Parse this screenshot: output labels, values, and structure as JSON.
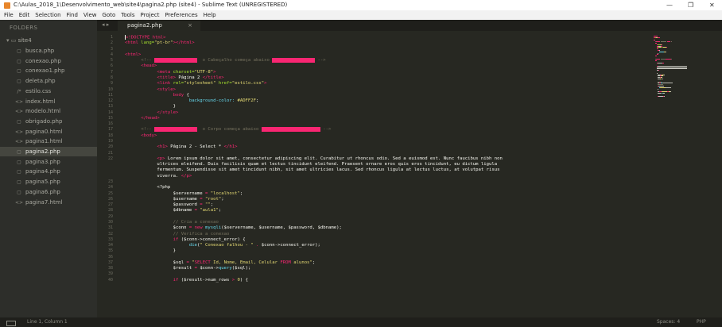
{
  "window": {
    "title": "C:\\Aulas_2018_1\\Desenvolvimento_web\\site4\\pagina2.php (site4) - Sublime Text (UNREGISTERED)",
    "minimize": "—",
    "maximize": "❐",
    "close": "✕"
  },
  "menu": [
    "File",
    "Edit",
    "Selection",
    "Find",
    "View",
    "Goto",
    "Tools",
    "Project",
    "Preferences",
    "Help"
  ],
  "sidebar": {
    "header": "FOLDERS",
    "root": "site4",
    "items": [
      {
        "icon": "file-icon",
        "glyph": "▢",
        "label": "busca.php"
      },
      {
        "icon": "file-icon",
        "glyph": "▢",
        "label": "conexao.php"
      },
      {
        "icon": "file-icon",
        "glyph": "▢",
        "label": "conexao1.php"
      },
      {
        "icon": "file-icon",
        "glyph": "▢",
        "label": "deleta.php"
      },
      {
        "icon": "css-file-icon",
        "glyph": "/*",
        "label": "estilo.css"
      },
      {
        "icon": "html-file-icon",
        "glyph": "<>",
        "label": "index.html"
      },
      {
        "icon": "html-file-icon",
        "glyph": "<>",
        "label": "modelo.html"
      },
      {
        "icon": "file-icon",
        "glyph": "▢",
        "label": "obrigado.php"
      },
      {
        "icon": "html-file-icon",
        "glyph": "<>",
        "label": "pagina0.html"
      },
      {
        "icon": "html-file-icon",
        "glyph": "<>",
        "label": "pagina1.html"
      },
      {
        "icon": "file-icon",
        "glyph": "▢",
        "label": "pagina2.php",
        "selected": true
      },
      {
        "icon": "file-icon",
        "glyph": "▢",
        "label": "pagina3.php"
      },
      {
        "icon": "file-icon",
        "glyph": "▢",
        "label": "pagina4.php"
      },
      {
        "icon": "file-icon",
        "glyph": "▢",
        "label": "pagina5.php"
      },
      {
        "icon": "file-icon",
        "glyph": "▢",
        "label": "pagina6.php"
      },
      {
        "icon": "html-file-icon",
        "glyph": "<>",
        "label": "pagina7.html"
      }
    ]
  },
  "tab": {
    "nav": "◂ ▸",
    "label": "pagina2.php",
    "close": "×"
  },
  "editor": {
    "lines": [
      {
        "n": "1",
        "segs": [
          [
            "tg",
            "<!DOCTYPE html>"
          ]
        ],
        "cursor": true
      },
      {
        "n": "2",
        "segs": [
          [
            "tg",
            "<html "
          ],
          [
            "at",
            "lang="
          ],
          [
            "st",
            "\"pt-br\""
          ],
          [
            "tg",
            "></html>"
          ]
        ]
      },
      {
        "n": "3",
        "segs": []
      },
      {
        "n": "4",
        "segs": [
          [
            "tg",
            "<html>"
          ]
        ]
      },
      {
        "n": "5",
        "segs": [
          [
            "cm",
            "      <!-- "
          ],
          [
            "hl",
            "================"
          ],
          [
            "cm",
            "  o Cabeçalho começa abaixo "
          ],
          [
            "hl",
            "================"
          ],
          [
            "cm",
            " -->"
          ]
        ]
      },
      {
        "n": "6",
        "segs": [
          [
            "tg",
            "      <head>"
          ]
        ]
      },
      {
        "n": "7",
        "segs": [
          [
            "tg",
            "            <meta "
          ],
          [
            "at",
            "charset="
          ],
          [
            "st",
            "\"UTF-8\""
          ],
          [
            "tg",
            ">"
          ]
        ]
      },
      {
        "n": "8",
        "segs": [
          [
            "tg",
            "            <title>"
          ],
          [
            "vr",
            " Página 2 "
          ],
          [
            "tg",
            "</title>"
          ]
        ]
      },
      {
        "n": "9",
        "segs": [
          [
            "tg",
            "            <link "
          ],
          [
            "at",
            "rel="
          ],
          [
            "st",
            "\"stylesheet\" "
          ],
          [
            "at",
            "href="
          ],
          [
            "st",
            "\"estilo.css\""
          ],
          [
            "tg",
            ">"
          ]
        ]
      },
      {
        "n": "10",
        "segs": [
          [
            "tg",
            "            <style>"
          ]
        ]
      },
      {
        "n": "11",
        "segs": [
          [
            "tg",
            "                  body "
          ],
          [
            "vr",
            "{"
          ]
        ]
      },
      {
        "n": "12",
        "segs": [
          [
            "fn",
            "                        background-color: "
          ],
          [
            "st",
            "#ADFF2F"
          ],
          [
            "vr",
            ";"
          ]
        ]
      },
      {
        "n": "13",
        "segs": [
          [
            "vr",
            "                  }"
          ]
        ]
      },
      {
        "n": "14",
        "segs": [
          [
            "tg",
            "            </style>"
          ]
        ]
      },
      {
        "n": "15",
        "segs": [
          [
            "tg",
            "      </head>"
          ]
        ]
      },
      {
        "n": "16",
        "segs": []
      },
      {
        "n": "17",
        "segs": [
          [
            "cm",
            "      <!-- "
          ],
          [
            "hl",
            "================"
          ],
          [
            "cm",
            "  o Corpo começa abaixo "
          ],
          [
            "hl",
            "======================"
          ],
          [
            "cm",
            " -->"
          ]
        ]
      },
      {
        "n": "18",
        "segs": [
          [
            "tg",
            "      <body>"
          ]
        ]
      },
      {
        "n": "19",
        "segs": []
      },
      {
        "n": "20",
        "segs": [
          [
            "tg",
            "            <h1>"
          ],
          [
            "vr",
            " Página 2 - Select * "
          ],
          [
            "tg",
            "</h1>"
          ]
        ]
      },
      {
        "n": "21",
        "segs": []
      },
      {
        "n": "22",
        "segs": [
          [
            "tg",
            "            <p>"
          ],
          [
            "vr",
            " Lorem ipsum dolor sit amet, consectetur adipiscing elit. Curabitur ut rhoncus odio. Sed a euismod est. Nunc faucibus nibh non"
          ]
        ]
      },
      {
        "n": "",
        "segs": [
          [
            "vr",
            "            ultrices eleifend. Duis facilisis quam et lectus tincidunt eleifend. Praesent ornare eros quis eros tincidunt, eu dictum ligula"
          ]
        ]
      },
      {
        "n": "",
        "segs": [
          [
            "vr",
            "            fermentum. Suspendisse sit amet tincidunt nibh, sit amet ultricies lacus. Sed rhoncus ligula at lectus luctus, at volutpat risus"
          ]
        ]
      },
      {
        "n": "",
        "segs": [
          [
            "vr",
            "            viverra. "
          ],
          [
            "tg",
            "</p>"
          ]
        ]
      },
      {
        "n": "23",
        "segs": []
      },
      {
        "n": "24",
        "segs": [
          [
            "vr",
            "            <?php"
          ]
        ]
      },
      {
        "n": "25",
        "segs": [
          [
            "vr",
            "                  $servername "
          ],
          [
            "kw",
            "= "
          ],
          [
            "st",
            "\"localhost\""
          ],
          [
            "vr",
            ";"
          ]
        ]
      },
      {
        "n": "26",
        "segs": [
          [
            "vr",
            "                  $username "
          ],
          [
            "kw",
            "= "
          ],
          [
            "st",
            "\"root\""
          ],
          [
            "vr",
            ";"
          ]
        ]
      },
      {
        "n": "27",
        "segs": [
          [
            "vr",
            "                  $password "
          ],
          [
            "kw",
            "= "
          ],
          [
            "st",
            "\"\""
          ],
          [
            "vr",
            ";"
          ]
        ]
      },
      {
        "n": "28",
        "segs": [
          [
            "vr",
            "                  $dbname "
          ],
          [
            "kw",
            "= "
          ],
          [
            "st",
            "\"aula1\""
          ],
          [
            "vr",
            ";"
          ]
        ]
      },
      {
        "n": "29",
        "segs": []
      },
      {
        "n": "30",
        "segs": [
          [
            "cm",
            "                  // Cria a conexao"
          ]
        ]
      },
      {
        "n": "31",
        "segs": [
          [
            "vr",
            "                  $conn "
          ],
          [
            "kw",
            "= new "
          ],
          [
            "fn",
            "mysqli"
          ],
          [
            "vr",
            "($servername, $username, $password, $dbname);"
          ]
        ]
      },
      {
        "n": "32",
        "segs": [
          [
            "cm",
            "                  // Verifica a conexao"
          ]
        ]
      },
      {
        "n": "33",
        "segs": [
          [
            "kw",
            "                  if "
          ],
          [
            "vr",
            "($conn->connect_error) {"
          ]
        ]
      },
      {
        "n": "34",
        "segs": [
          [
            "fn",
            "                        die"
          ],
          [
            "vr",
            "("
          ],
          [
            "st",
            "\" Conexao falhou - \" "
          ],
          [
            "kw",
            ". "
          ],
          [
            "vr",
            "$conn->connect_error);"
          ]
        ]
      },
      {
        "n": "35",
        "segs": [
          [
            "vr",
            "                  }"
          ]
        ]
      },
      {
        "n": "36",
        "segs": []
      },
      {
        "n": "37",
        "segs": [
          [
            "vr",
            "                  $sql "
          ],
          [
            "kw",
            "= "
          ],
          [
            "st",
            "\""
          ],
          [
            "kw",
            "SELECT "
          ],
          [
            "st",
            "Id, Nome, Email, Celular "
          ],
          [
            "kw",
            "FROM "
          ],
          [
            "st",
            "alunos\""
          ],
          [
            "vr",
            ";"
          ]
        ]
      },
      {
        "n": "38",
        "segs": [
          [
            "vr",
            "                  $result "
          ],
          [
            "kw",
            "= "
          ],
          [
            "vr",
            "$conn->"
          ],
          [
            "fn",
            "query"
          ],
          [
            "vr",
            "($sql);"
          ]
        ]
      },
      {
        "n": "39",
        "segs": []
      },
      {
        "n": "40",
        "segs": [
          [
            "kw",
            "                  if "
          ],
          [
            "vr",
            "($result->num_rows "
          ],
          [
            "kw",
            "> "
          ],
          [
            "st",
            "0"
          ],
          [
            "vr",
            ") {"
          ]
        ]
      }
    ]
  },
  "status": {
    "left": "Line 1, Column 1",
    "spaces": "Spaces: 4",
    "syntax": "PHP"
  }
}
